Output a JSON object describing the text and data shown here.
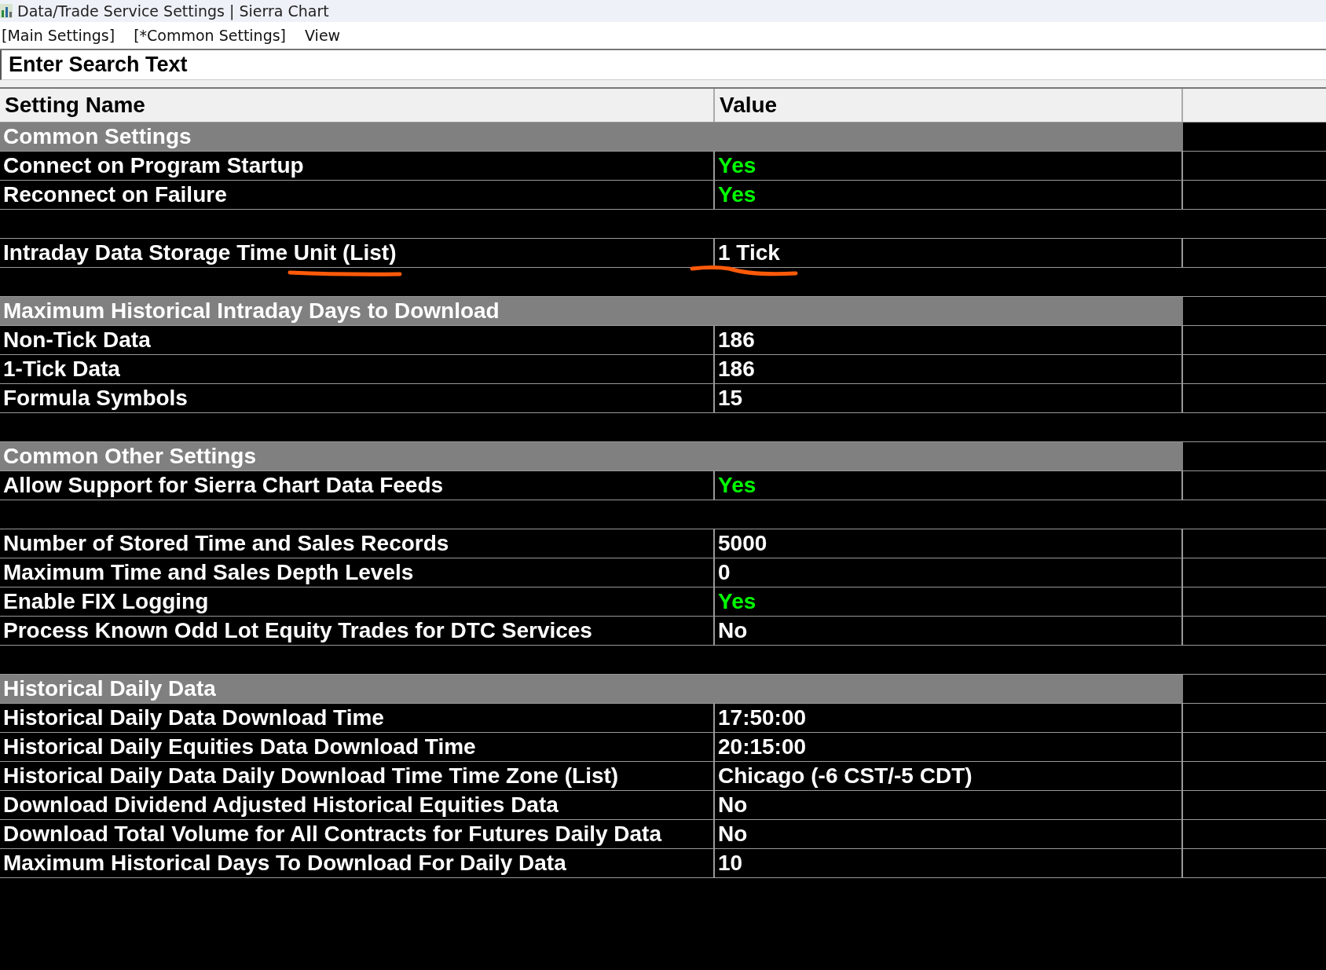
{
  "window": {
    "title": "Data/Trade Service Settings | Sierra Chart"
  },
  "menu": [
    {
      "label": "[Main Settings]"
    },
    {
      "label": "[*Common Settings]"
    },
    {
      "label": "View"
    }
  ],
  "search": {
    "placeholder": "Enter Search Text"
  },
  "table": {
    "columns": [
      "Setting Name",
      "Value"
    ],
    "rows": [
      {
        "kind": "section",
        "name": "Common Settings"
      },
      {
        "kind": "setting",
        "name": "Connect on Program Startup",
        "value": "Yes",
        "color": "#00ff00"
      },
      {
        "kind": "setting",
        "name": "Reconnect on Failure",
        "value": "Yes",
        "color": "#00ff00"
      },
      {
        "kind": "blank"
      },
      {
        "kind": "setting",
        "name": "Intraday Data Storage Time Unit (List)",
        "value": "1 Tick",
        "color": "#ffffff",
        "underlined": true
      },
      {
        "kind": "blank"
      },
      {
        "kind": "section",
        "name": "Maximum Historical Intraday Days to Download"
      },
      {
        "kind": "setting",
        "name": "Non-Tick Data",
        "value": "186",
        "color": "#ffffff"
      },
      {
        "kind": "setting",
        "name": "1-Tick Data",
        "value": "186",
        "color": "#ffffff"
      },
      {
        "kind": "setting",
        "name": "Formula Symbols",
        "value": "15",
        "color": "#ffffff"
      },
      {
        "kind": "blank"
      },
      {
        "kind": "section",
        "name": "Common Other Settings"
      },
      {
        "kind": "setting",
        "name": "Allow Support for Sierra Chart Data Feeds",
        "value": "Yes",
        "color": "#00ff00"
      },
      {
        "kind": "blank"
      },
      {
        "kind": "setting",
        "name": "Number of Stored Time and Sales Records",
        "value": "5000",
        "color": "#ffffff"
      },
      {
        "kind": "setting",
        "name": "Maximum Time and Sales Depth Levels",
        "value": "0",
        "color": "#ffffff"
      },
      {
        "kind": "setting",
        "name": "Enable FIX Logging",
        "value": "Yes",
        "color": "#00ff00"
      },
      {
        "kind": "setting",
        "name": "Process Known Odd Lot Equity Trades for DTC Services",
        "value": "No",
        "color": "#ffffff"
      },
      {
        "kind": "blank"
      },
      {
        "kind": "section",
        "name": "Historical Daily Data"
      },
      {
        "kind": "setting",
        "name": "Historical Daily Data Download Time",
        "value": "17:50:00",
        "color": "#ffffff"
      },
      {
        "kind": "setting",
        "name": "Historical Daily Equities Data Download Time",
        "value": "20:15:00",
        "color": "#ffffff"
      },
      {
        "kind": "setting",
        "name": "Historical Daily Data Daily Download Time Time Zone (List)",
        "value": "Chicago (-6 CST/-5 CDT)",
        "color": "#ffffff"
      },
      {
        "kind": "setting",
        "name": "Download Dividend Adjusted Historical Equities Data",
        "value": "No",
        "color": "#ffffff"
      },
      {
        "kind": "setting",
        "name": "Download Total Volume for All Contracts for Futures Daily Data",
        "value": "No",
        "color": "#ffffff"
      },
      {
        "kind": "setting",
        "name": "Maximum Historical Days To Download For Daily Data",
        "value": "10",
        "color": "#ffffff"
      }
    ]
  }
}
